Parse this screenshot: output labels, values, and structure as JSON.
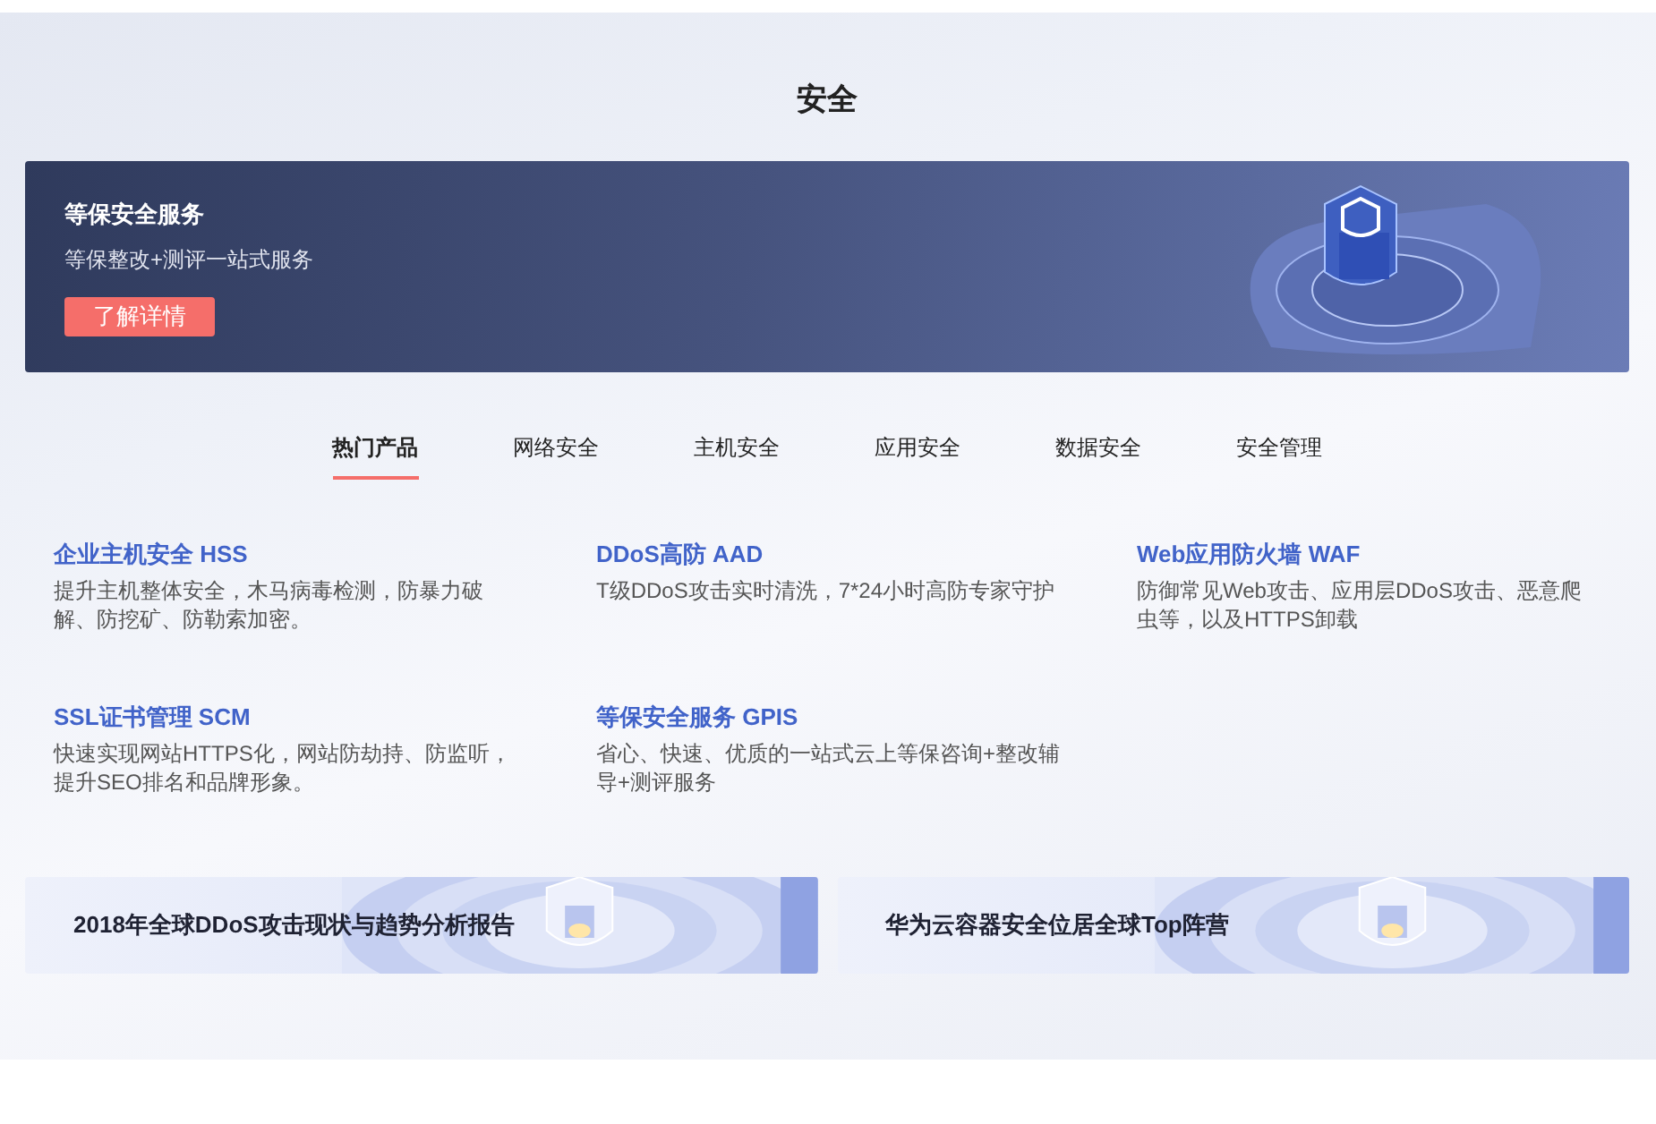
{
  "title": "安全",
  "banner": {
    "title": "等保安全服务",
    "subtitle": "等保整改+测评一站式服务",
    "button": "了解详情"
  },
  "tabs": [
    {
      "label": "热门产品",
      "selected": true
    },
    {
      "label": "网络安全",
      "selected": false
    },
    {
      "label": "主机安全",
      "selected": false
    },
    {
      "label": "应用安全",
      "selected": false
    },
    {
      "label": "数据安全",
      "selected": false
    },
    {
      "label": "安全管理",
      "selected": false
    }
  ],
  "products": [
    {
      "name": "企业主机安全 HSS",
      "description": "提升主机整体安全，木马病毒检测，防暴力破解、防挖矿、防勒索加密。"
    },
    {
      "name": "DDoS高防 AAD",
      "description": "T级DDoS攻击实时清洗，7*24小时高防专家守护"
    },
    {
      "name": "Web应用防火墙 WAF",
      "description": "防御常见Web攻击、应用层DDoS攻击、恶意爬虫等，以及HTTPS卸载"
    },
    {
      "name": "SSL证书管理 SCM",
      "description": "快速实现网站HTTPS化，网站防劫持、防监听，提升SEO排名和品牌形象。"
    },
    {
      "name": "等保安全服务 GPIS",
      "description": "省心、快速、优质的一站式云上等保咨询+整改辅导+测评服务"
    }
  ],
  "promos": [
    {
      "title": "2018年全球DDoS攻击现状与趋势分析报告"
    },
    {
      "title": "华为云容器安全位居全球Top阵营"
    }
  ]
}
